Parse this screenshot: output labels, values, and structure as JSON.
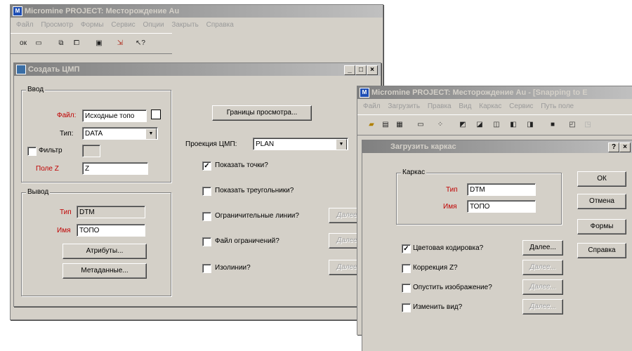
{
  "main_app": {
    "title": "Micromine    PROJECT: Месторождение Au",
    "menu": [
      "Файл",
      "Просмотр",
      "Формы",
      "Сервис",
      "Опции",
      "Закрыть",
      "Справка"
    ],
    "toolbar": [
      {
        "icon": "ok-icon",
        "glyph": "ок"
      },
      {
        "icon": "display-icon",
        "glyph": "▭"
      },
      {
        "icon": "copy-icon",
        "glyph": "⧉"
      },
      {
        "icon": "window-icon",
        "glyph": "⧠"
      },
      {
        "icon": "chart-icon",
        "glyph": "▣"
      },
      {
        "icon": "exit-icon",
        "glyph": "⇲"
      },
      {
        "icon": "help-icon",
        "glyph": "↖?"
      }
    ]
  },
  "dtm_dialog": {
    "title": "Создать ЦМП",
    "input_group": {
      "label": "Ввод",
      "file_label": "Файл:",
      "file_value": "Исходные топо",
      "type_label": "Тип:",
      "type_value": "DATA",
      "filter_label": "Фильтр",
      "field_z_label": "Поле Z",
      "field_z_value": "Z"
    },
    "output_group": {
      "label": "Вывод",
      "type_label": "Тип",
      "type_value": "DTM",
      "name_label": "Имя",
      "name_value": "ТОПО",
      "attributes_button": "Атрибуты...",
      "metadata_button": "Метаданные..."
    },
    "view_bounds_button": "Границы просмотра...",
    "projection_label": "Проекция ЦМП:",
    "projection_value": "PLAN",
    "options": [
      {
        "label": "Показать точки?",
        "checked": true,
        "has_more": false
      },
      {
        "label": "Показать треугольники?",
        "checked": false,
        "has_more": false
      },
      {
        "label": "Ограничительные линии?",
        "checked": false,
        "has_more": true
      },
      {
        "label": "Файл ограничений?",
        "checked": false,
        "has_more": true
      },
      {
        "label": "Изолинии?",
        "checked": false,
        "has_more": true
      }
    ],
    "more_label": "Далее"
  },
  "second_app": {
    "title": "Micromine    PROJECT: Месторождение Au - [Snapping to E",
    "menu": [
      "Файл",
      "Загрузить",
      "Правка",
      "Вид",
      "Каркас",
      "Сервис",
      "Путь поле"
    ]
  },
  "wireframe_dialog": {
    "title": "Загрузить каркас",
    "help_glyph": "?",
    "close_glyph": "×",
    "group_label": "Каркас",
    "type_label": "Тип",
    "type_value": "DTM",
    "name_label": "Имя",
    "name_value": "ТОПО",
    "ok_button": "ОК",
    "cancel_button": "Отмена",
    "forms_button": "Формы",
    "help_button": "Справка",
    "options": [
      {
        "label": "Цветовая кодировка?",
        "checked": true,
        "more_enabled": true
      },
      {
        "label": "Коррекция Z?",
        "checked": false,
        "more_enabled": false
      },
      {
        "label": "Опустить изображение?",
        "checked": false,
        "more_enabled": false
      },
      {
        "label": "Изменить вид?",
        "checked": false,
        "more_enabled": false
      }
    ],
    "more_label": "Далее..."
  }
}
